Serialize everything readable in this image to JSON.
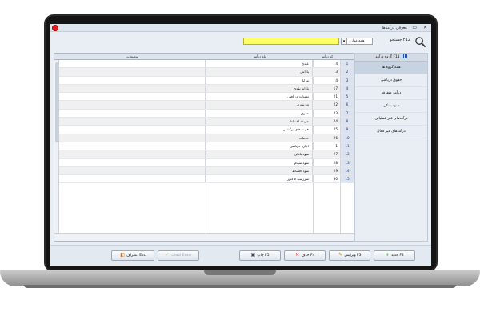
{
  "window": {
    "title": "معرفی درآمدها",
    "controls": "— ▭ ✕"
  },
  "toolbar": {
    "search_label": "جستجو F12",
    "field_select": "همه موارد",
    "search_value": "",
    "dropdown_arrow": "▾"
  },
  "sidebar": {
    "header": "گروه درآمد F11",
    "items": [
      {
        "label": "همه گروه ها"
      },
      {
        "label": "حقوق دریافتی"
      },
      {
        "label": "درآمد متفرقه"
      },
      {
        "label": "سود بانکی"
      },
      {
        "label": "درآمدهای غیر عملیاتی"
      },
      {
        "label": "درآمدهای غیر فعال"
      }
    ]
  },
  "grid": {
    "headers": {
      "desc": "توضیحات",
      "name": "نام درآمد",
      "code": "کد درآمد",
      "num": ""
    },
    "rows": [
      {
        "num": "1",
        "code": "4",
        "name": "عیدی",
        "desc": ""
      },
      {
        "num": "2",
        "code": "3",
        "name": "پاداش",
        "desc": ""
      },
      {
        "num": "3",
        "code": "4",
        "name": "مزایا",
        "desc": ""
      },
      {
        "num": "4",
        "code": "17",
        "name": "یارانه نقدی",
        "desc": ""
      },
      {
        "num": "5",
        "code": "21",
        "name": "تعهدات دریافتی",
        "desc": ""
      },
      {
        "num": "6",
        "code": "22",
        "name": "ویزیتوری",
        "desc": ""
      },
      {
        "num": "7",
        "code": "23",
        "name": "حقوق",
        "desc": ""
      },
      {
        "num": "8",
        "code": "24",
        "name": "جریمه اقساط",
        "desc": ""
      },
      {
        "num": "9",
        "code": "25",
        "name": "هزینه های برگشتی",
        "desc": ""
      },
      {
        "num": "10",
        "code": "26",
        "name": "خدمات",
        "desc": ""
      },
      {
        "num": "11",
        "code": "1",
        "name": "اجاره دریافتی",
        "desc": ""
      },
      {
        "num": "12",
        "code": "27",
        "name": "سود بانکی",
        "desc": ""
      },
      {
        "num": "13",
        "code": "28",
        "name": "سود سهام",
        "desc": ""
      },
      {
        "num": "14",
        "code": "29",
        "name": "سود اقساط",
        "desc": ""
      },
      {
        "num": "15",
        "code": "30",
        "name": "سررسید فاکتور",
        "desc": ""
      }
    ]
  },
  "buttons": {
    "new": "جدید F2",
    "edit": "ویرایش F3",
    "delete": "حذف F4",
    "print": "چاپ F5",
    "select": "انتخاب Enter",
    "cancel": "انصراف Esc"
  },
  "colors": {
    "search_bg": "#ffff66",
    "badge": "#e02020",
    "add_icon": "#2e9e2e",
    "delete_icon": "#d02020"
  }
}
